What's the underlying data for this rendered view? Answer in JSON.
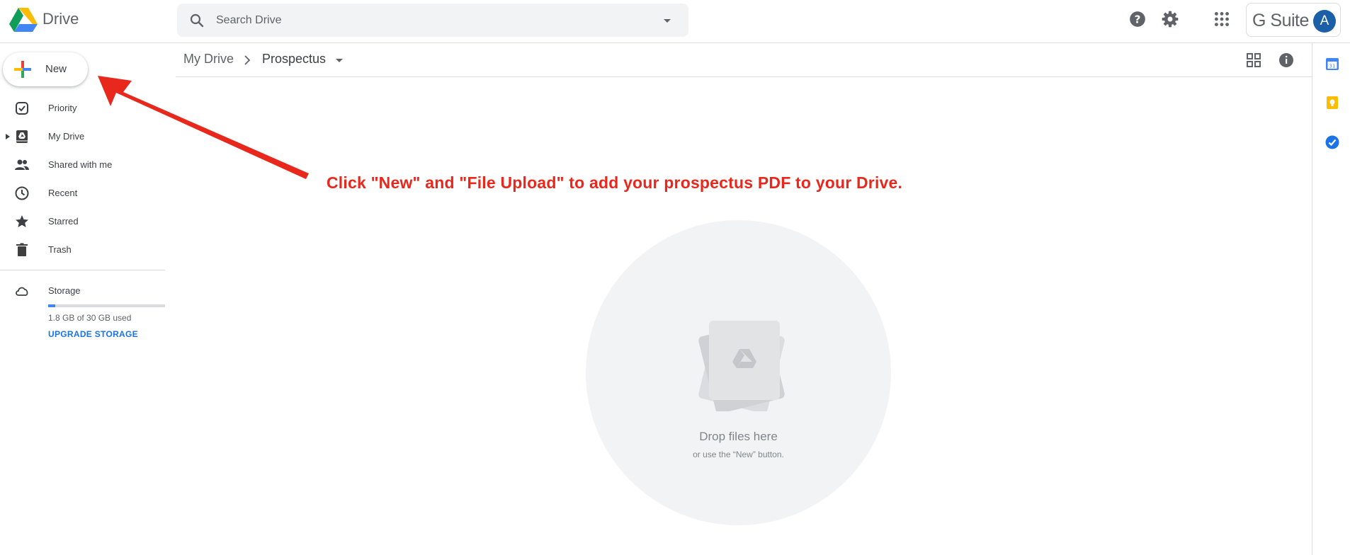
{
  "app": {
    "title": "Drive"
  },
  "search": {
    "placeholder": "Search Drive"
  },
  "header": {
    "brand": "G Suite",
    "avatar_initial": "A"
  },
  "sidebar": {
    "new_label": "New",
    "items": [
      {
        "label": "Priority",
        "icon": "priority-icon"
      },
      {
        "label": "My Drive",
        "icon": "my-drive-icon"
      },
      {
        "label": "Shared with me",
        "icon": "shared-icon"
      },
      {
        "label": "Recent",
        "icon": "clock-icon"
      },
      {
        "label": "Starred",
        "icon": "star-icon"
      },
      {
        "label": "Trash",
        "icon": "trash-icon"
      }
    ],
    "storage": {
      "label": "Storage",
      "used_text": "1.8 GB of 30 GB used",
      "used_fraction": 0.06,
      "upgrade_label": "UPGRADE STORAGE"
    }
  },
  "breadcrumb": {
    "root": "My Drive",
    "current": "Prospectus"
  },
  "annotation": {
    "text": "Click \"New\" and \"File Upload\" to add your prospectus PDF to your Drive."
  },
  "empty_state": {
    "title": "Drop files here",
    "subtitle": "or use the “New” button."
  },
  "colors": {
    "accent": "#1a73e8",
    "annotation": "#e8281c",
    "avatar": "#1a5fa8"
  }
}
